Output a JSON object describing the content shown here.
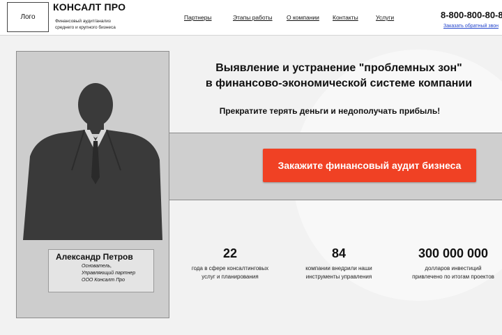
{
  "header": {
    "logo_label": "Лого",
    "brand": "КОНСАЛТ ПРО",
    "brand_sub_line1": "Финансовый аудит/анализ",
    "brand_sub_line2": "среднего и крупного бизнеса",
    "nav": [
      {
        "label": "Партнеры"
      },
      {
        "label": "Этапы работы"
      },
      {
        "label": "О компании"
      },
      {
        "label": "Контакты"
      },
      {
        "label": "Услуги"
      }
    ],
    "phone": "8-800-800-80-8",
    "callback_link": "Заказать обратный звон"
  },
  "hero": {
    "headline_line1": "Выявление и устранение  \"проблемных зон\"",
    "headline_line2": "в финансово-экономической системе компании",
    "subheadline": "Прекратите терять деньги и недополучать прибыль!",
    "cta_label": "Закажите финансовый аудит бизнеса"
  },
  "person": {
    "name": "Александр Петров",
    "role_line1": "Основатель,",
    "role_line2": "Управляющий партнер",
    "role_line3": "ООО Консалт Про"
  },
  "stats": [
    {
      "number": "22",
      "desc_line1": "года в сфере консалтинговых",
      "desc_line2": "услуг и планирования"
    },
    {
      "number": "84",
      "desc_line1": "компании внедрили наши",
      "desc_line2": "инструменты управления"
    },
    {
      "number": "300 000 000",
      "desc_line1": "долларов инвестиций",
      "desc_line2": "привлечено по итогам проектов"
    }
  ],
  "colors": {
    "cta_background": "#f04124",
    "link": "#2244cc",
    "silhouette": "#3a3a3a"
  }
}
